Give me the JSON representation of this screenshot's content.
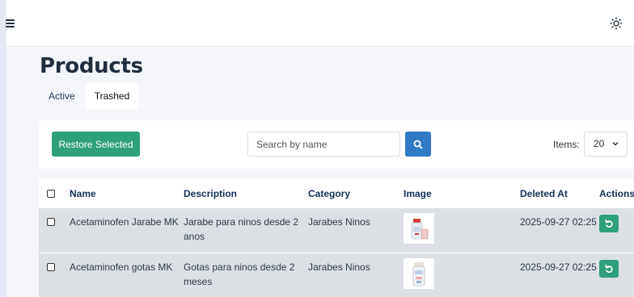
{
  "page": {
    "title": "Products"
  },
  "tabs": [
    {
      "label": "Active"
    },
    {
      "label": "Trashed"
    }
  ],
  "toolbar": {
    "restore_label": "Restore Selected",
    "search_placeholder": "Search by name",
    "items_label": "Items:",
    "items_value": "20"
  },
  "table": {
    "headers": [
      "Name",
      "Description",
      "Category",
      "Image",
      "Deleted At",
      "Actions"
    ],
    "rows": [
      {
        "name": "Acetaminofen Jarabe MK",
        "description": "Jarabe para ninos desde 2 anos",
        "category": "Jarabes Ninos",
        "deleted_at": "2025-09-27 02:25"
      },
      {
        "name": "Acetaminofen gotas MK",
        "description": "Gotas para ninos desde 2 meses",
        "category": "Jarabes Ninos",
        "deleted_at": "2025-09-27 02:25"
      }
    ]
  },
  "icons": {
    "menu": "hamburger-icon",
    "theme": "sun-icon",
    "search": "search-icon",
    "dropdown": "chevron-down-icon",
    "restore": "undo-icon"
  },
  "colors": {
    "primary_green": "#2ea07b",
    "search_blue": "#2f7ac4",
    "page_background": "#f4f6f9"
  }
}
